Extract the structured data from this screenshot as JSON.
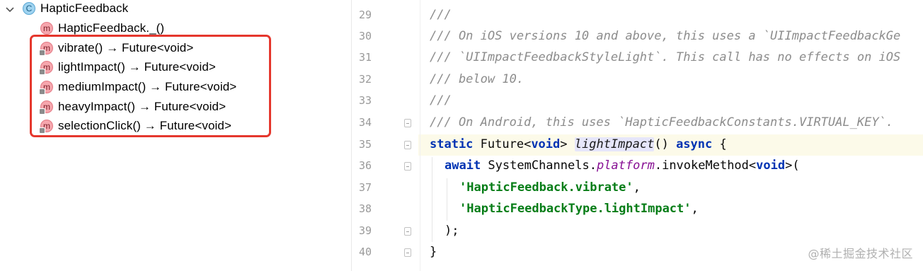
{
  "structure": {
    "class_badge": "C",
    "method_badge": "m",
    "root": {
      "label": "HapticFeedback",
      "icon": "class-icon"
    },
    "items": [
      {
        "label": "HapticFeedback._()"
      },
      {
        "label": "vibrate() → Future<void>"
      },
      {
        "label": "lightImpact() → Future<void>"
      },
      {
        "label": "mediumImpact() → Future<void>"
      },
      {
        "label": "heavyImpact() → Future<void>"
      },
      {
        "label": "selectionClick() → Future<void>"
      }
    ]
  },
  "editor": {
    "line_numbers": [
      "29",
      "30",
      "31",
      "32",
      "33",
      "34",
      "35",
      "36",
      "37",
      "38",
      "39",
      "40"
    ],
    "lines": {
      "l29": "///",
      "l30": "/// On iOS versions 10 and above, this uses a `UIImpactFeedbackGe",
      "l31": "/// `UIImpactFeedbackStyleLight`. This call has no effects on iOS",
      "l32": "/// below 10.",
      "l33": "///",
      "l34": "/// On Android, this uses `HapticFeedbackConstants.VIRTUAL_KEY`.",
      "l35": {
        "kw": "static",
        "type": " Future<",
        "kw2": "void",
        "type2": "> ",
        "fn": "lightImpact",
        "rest": "() ",
        "kw3": "async",
        "brace": " {"
      },
      "l36": {
        "kw": "await",
        "a": " SystemChannels.",
        "field": "platform",
        "b": ".invokeMethod<",
        "kw2": "void",
        "c": ">("
      },
      "l37": {
        "str": "'HapticFeedback.vibrate'",
        "tail": ","
      },
      "l38": {
        "str": "'HapticFeedbackType.lightImpact'",
        "tail": ","
      },
      "l39": ");",
      "l40": "}"
    }
  },
  "watermark": "@稀土掘金技术社区",
  "colors": {
    "highlight_box": "#e5372d",
    "keyword": "#0033b3",
    "string": "#067d17",
    "comment": "#8c8c8c"
  }
}
